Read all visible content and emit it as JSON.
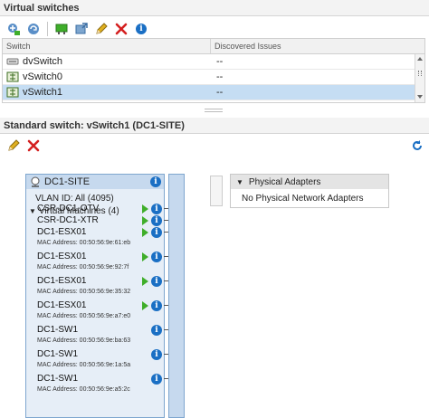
{
  "virtual_switches": {
    "header": "Virtual switches",
    "columns": [
      "Switch",
      "Discovered Issues"
    ],
    "rows": [
      {
        "name": "dvSwitch",
        "issues": "--",
        "selected": false
      },
      {
        "name": "vSwitch0",
        "issues": "--",
        "selected": false
      },
      {
        "name": "vSwitch1",
        "issues": "--",
        "selected": true
      }
    ]
  },
  "detail": {
    "header": "Standard switch: vSwitch1 (DC1-SITE)"
  },
  "switch_panel": {
    "name": "DC1-SITE",
    "vlan": "VLAN ID: All (4095)",
    "vm_group": "Virtual Machines (4)",
    "vms": [
      {
        "name": "CSR-DC1-OTV",
        "mac": "",
        "powered": true
      },
      {
        "name": "CSR-DC1-XTR",
        "mac": "",
        "powered": true
      },
      {
        "name": "DC1-ESX01",
        "mac": "MAC Address: 00:50:56:9e:61:eb",
        "powered": true
      },
      {
        "name": "DC1-ESX01",
        "mac": "MAC Address: 00:50:56:9e:92:7f",
        "powered": true
      },
      {
        "name": "DC1-ESX01",
        "mac": "MAC Address: 00:50:56:9e:35:32",
        "powered": true
      },
      {
        "name": "DC1-ESX01",
        "mac": "MAC Address: 00:50:56:9e:a7:e0",
        "powered": true
      },
      {
        "name": "DC1-SW1",
        "mac": "MAC Address: 00:50:56:9e:ba:63",
        "powered": false
      },
      {
        "name": "DC1-SW1",
        "mac": "MAC Address: 00:50:56:9e:1a:5a",
        "powered": false
      },
      {
        "name": "DC1-SW1",
        "mac": "MAC Address: 00:50:56:9e:a5:2c",
        "powered": false
      }
    ]
  },
  "physical_adapters": {
    "title": "Physical Adapters",
    "empty_text": "No Physical Network Adapters"
  },
  "colors": {
    "accent": "#1a6fc4",
    "selection": "#c5ddf3",
    "port_green": "#3fae2a",
    "delete_red": "#d42020"
  }
}
